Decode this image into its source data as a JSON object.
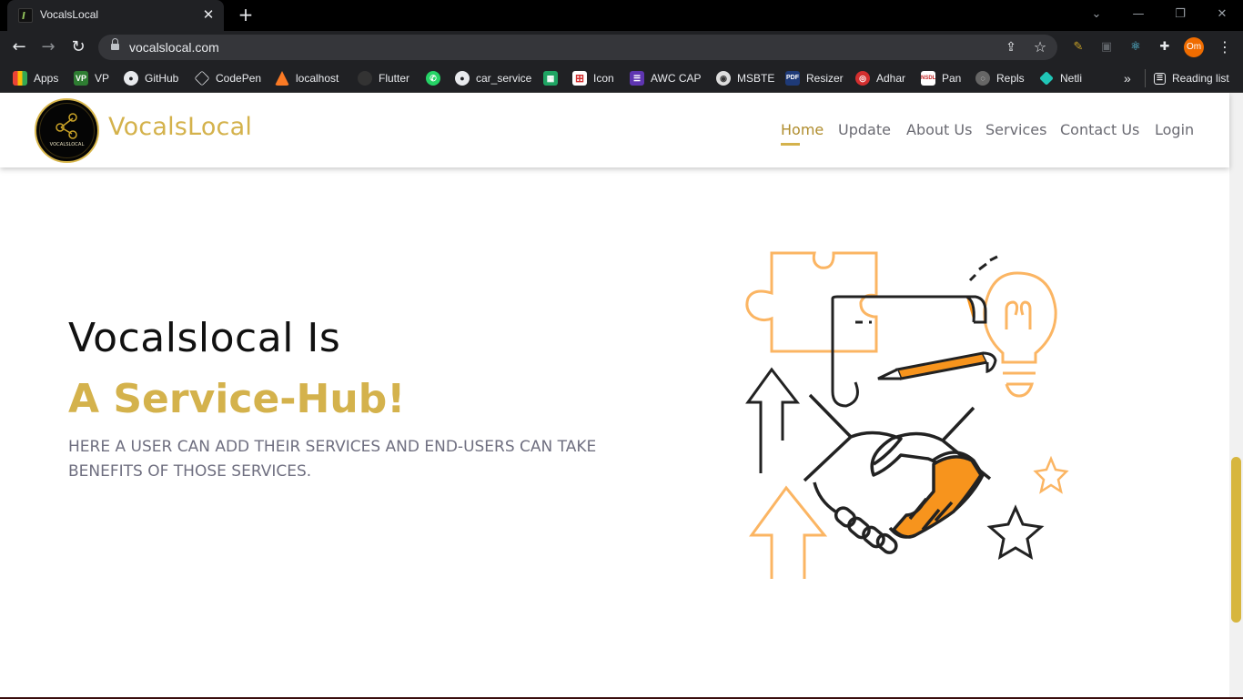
{
  "browser": {
    "tab_title": "VocalsLocal",
    "tab_close": "✕",
    "new_tab": "+",
    "url": "vocalslocal.com",
    "profile_initials": "Om",
    "window_controls": [
      "chevron-down-icon",
      "minimize-icon",
      "restore-icon",
      "close-icon"
    ],
    "bookmarks": [
      {
        "label": "Apps",
        "icon": "apps-grid-icon"
      },
      {
        "label": "VP",
        "icon": "vp-icon"
      },
      {
        "label": "GitHub",
        "icon": "github-icon"
      },
      {
        "label": "CodePen",
        "icon": "codepen-icon"
      },
      {
        "label": "localhost",
        "icon": "xampp-icon"
      },
      {
        "label": "Flutter",
        "icon": "flutter-icon"
      },
      {
        "label": "",
        "icon": "whatsapp-icon"
      },
      {
        "label": "car_service",
        "icon": "github-icon"
      },
      {
        "label": "",
        "icon": "sheets-icon"
      },
      {
        "label": "Icon",
        "icon": "grid-icon"
      },
      {
        "label": "AWC CAP",
        "icon": "list-icon"
      },
      {
        "label": "MSBTE",
        "icon": "msbte-icon"
      },
      {
        "label": "Resizer",
        "icon": "pdf-icon"
      },
      {
        "label": "Adhar",
        "icon": "aadhaar-icon"
      },
      {
        "label": "Pan",
        "icon": "nsdl-icon"
      },
      {
        "label": "Repls",
        "icon": "replit-icon"
      },
      {
        "label": "Netli",
        "icon": "netlify-icon"
      }
    ],
    "bookmarks_overflow": "»",
    "reading_list": "Reading list"
  },
  "site": {
    "brand": "VocalsLocal",
    "logo_text": "VOCALSLOCAL",
    "nav": [
      {
        "label": "Home",
        "active": true
      },
      {
        "label": "Update",
        "active": false
      },
      {
        "label": "About Us",
        "active": false
      },
      {
        "label": "Services",
        "active": false
      },
      {
        "label": "Contact Us",
        "active": false
      },
      {
        "label": "Login",
        "active": false
      }
    ]
  },
  "hero": {
    "line1": "Vocalslocal Is",
    "line2": "A Service-Hub!",
    "subtitle": "HERE A USER CAN ADD THEIR SERVICES AND END-USERS CAN TAKE BENEFITS OF THOSE SERVICES."
  },
  "colors": {
    "brand_gold": "#d4b24c",
    "illustration_orange": "#f7941d",
    "illustration_light_orange": "#fbb563",
    "chrome_dark": "#202124"
  }
}
